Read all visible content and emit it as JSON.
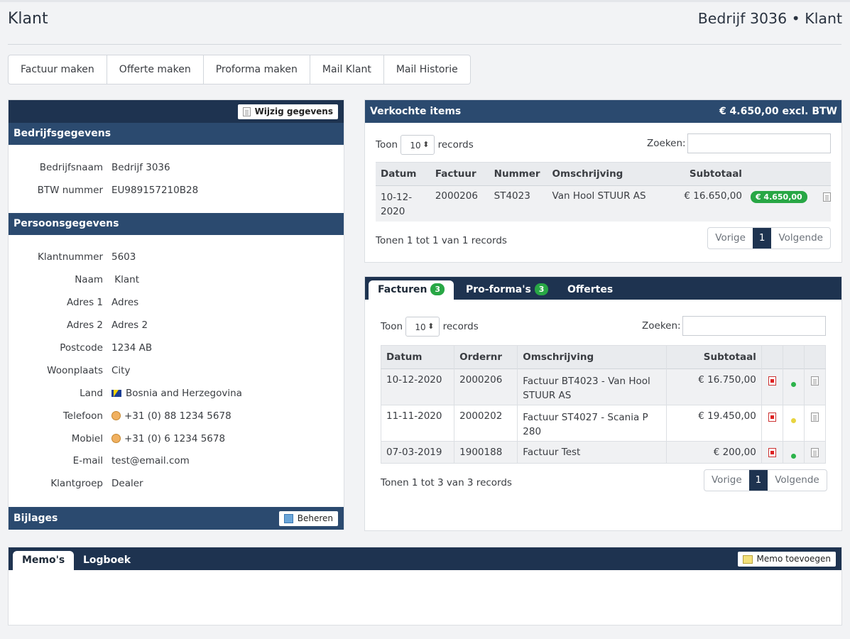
{
  "page": {
    "title": "Klant",
    "subtitle": "Bedrijf 3036 • Klant"
  },
  "toolbar": [
    "Factuur maken",
    "Offerte maken",
    "Proforma maken",
    "Mail Klant",
    "Mail Historie"
  ],
  "left": {
    "edit_button": "Wijzig gegevens",
    "company_header": "Bedrijfsgegevens",
    "company": [
      {
        "label": "Bedrijfsnaam",
        "value": "Bedrijf 3036"
      },
      {
        "label": "BTW nummer",
        "value": "EU989157210B28"
      }
    ],
    "person_header": "Persoonsgegevens",
    "person": [
      {
        "label": "Klantnummer",
        "value": "5603"
      },
      {
        "label": "Naam",
        "value": " Klant"
      },
      {
        "label": "Adres 1",
        "value": "Adres"
      },
      {
        "label": "Adres 2",
        "value": "Adres 2"
      },
      {
        "label": "Postcode",
        "value": "1234 AB"
      },
      {
        "label": "Woonplaats",
        "value": "City"
      },
      {
        "label": "Land",
        "value": "Bosnia and Herzegovina"
      },
      {
        "label": "Telefoon",
        "value": "+31 (0) 88 1234 5678"
      },
      {
        "label": "Mobiel",
        "value": "+31 (0) 6 1234 5678"
      },
      {
        "label": "E-mail",
        "value": "test@email.com"
      },
      {
        "label": "Klantgroep",
        "value": "Dealer"
      }
    ],
    "attachments_header": "Bijlages",
    "manage_button": "Beheren"
  },
  "sold": {
    "title": "Verkochte items",
    "total": "€ 4.650,00 excl. BTW",
    "show": "Toon",
    "page_size": "10",
    "records": "records",
    "search_label": "Zoeken:",
    "columns": [
      "Datum",
      "Factuur",
      "Nummer",
      "Omschrijving",
      "Subtotaal"
    ],
    "rows": [
      {
        "date_l1": "10-12-",
        "date_l2": "2020",
        "invoice": "2000206",
        "number": "ST4023",
        "description": "Van Hool STUUR AS",
        "subtotal": "€ 16.650,00",
        "badge": "€ 4.650,00"
      }
    ],
    "info": "Tonen 1 tot 1 van 1 records",
    "prev": "Vorige",
    "page": "1",
    "next": "Volgende"
  },
  "tabs": [
    {
      "label": "Facturen",
      "count": "3"
    },
    {
      "label": "Pro-forma's",
      "count": "3"
    },
    {
      "label": "Offertes"
    }
  ],
  "invoices": {
    "show": "Toon",
    "page_size": "10",
    "records": "records",
    "search_label": "Zoeken:",
    "columns": [
      "Datum",
      "Ordernr",
      "Omschrijving",
      "Subtotaal"
    ],
    "rows": [
      {
        "date": "10-12-2020",
        "order": "2000206",
        "desc_l1": "Factuur BT4023 - Van Hool",
        "desc_l2": "STUUR AS",
        "subtotal": "€ 16.750,00",
        "status_color": "#2cb34a"
      },
      {
        "date": "11-11-2020",
        "order": "2000202",
        "desc_l1": "Factuur ST4027 - Scania P",
        "desc_l2": "280",
        "subtotal": "€ 19.450,00",
        "status_color": "#e8d440"
      },
      {
        "date": "07-03-2019",
        "order": "1900188",
        "desc_l1": "Factuur Test",
        "desc_l2": "",
        "subtotal": "€ 200,00",
        "status_color": "#2cb34a"
      }
    ],
    "info": "Tonen 1 tot 3 van 3 records",
    "prev": "Vorige",
    "page": "1",
    "next": "Volgende"
  },
  "bottom": {
    "tabs": [
      "Memo's",
      "Logboek"
    ],
    "add_memo": "Memo toevoegen"
  }
}
